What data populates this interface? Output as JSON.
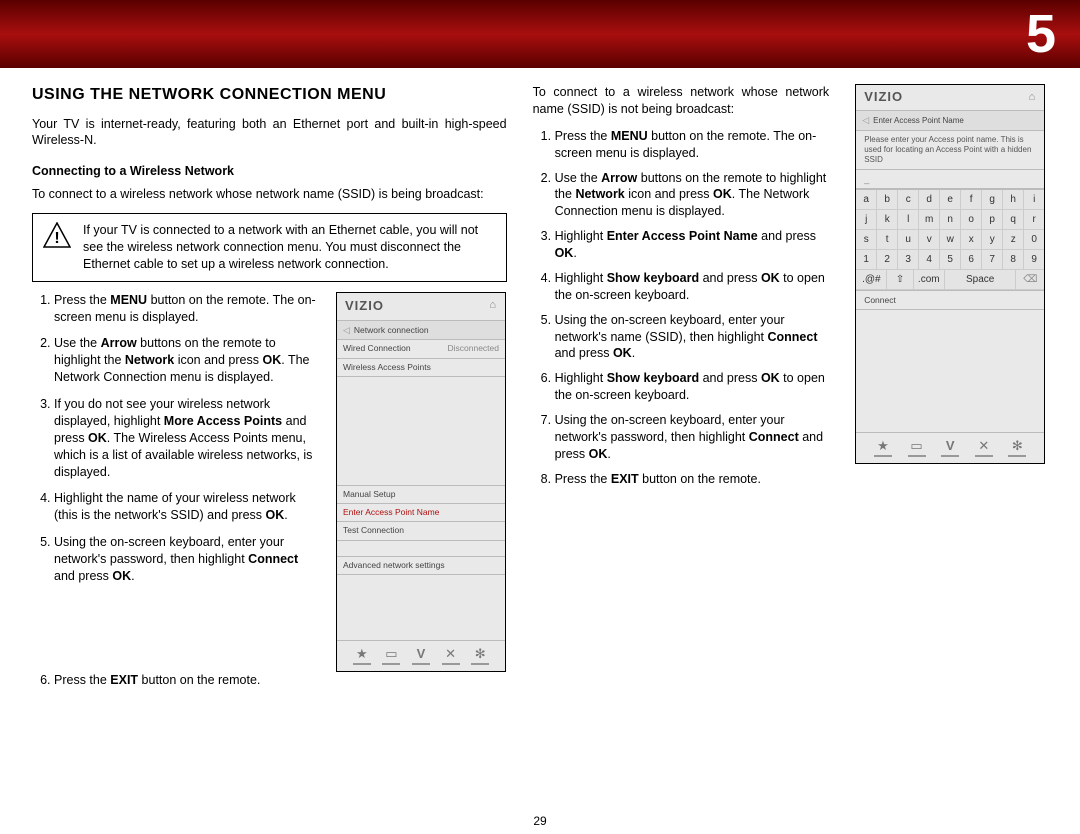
{
  "header": {
    "chapter_number": "5"
  },
  "col1": {
    "title": "USING THE NETWORK CONNECTION MENU",
    "intro": "Your TV is internet-ready, featuring both an Ethernet port and built-in high-speed Wireless-N.",
    "subhead": "Connecting to a Wireless Network",
    "lead_in": "To connect to a wireless network whose network name (SSID) is being broadcast:",
    "note": "If your TV is connected to a network with an Ethernet cable, you will not see the wireless network connection menu. You must disconnect the Ethernet cable to set up a wireless network connection.",
    "steps": [
      {
        "pre": "Press the ",
        "b": "MENU",
        "post": " button on the remote. The on-screen menu is displayed."
      },
      {
        "pre": "Use the ",
        "b": "Arrow",
        "mid": " buttons on the remote to highlight the ",
        "b2": "Network",
        "mid2": " icon and press ",
        "b3": "OK",
        "post": ". The Network Connection menu is displayed."
      },
      {
        "pre": "If you do not see your wireless network displayed, highlight ",
        "b": "More Access Points",
        "mid": " and press ",
        "b2": "OK",
        "post": ". The Wireless Access Points menu, which is a list of available wireless networks, is displayed."
      },
      {
        "pre": "Highlight the name of your wireless network (this is the network's SSID) and press ",
        "b": "OK",
        "post": "."
      },
      {
        "pre": "Using the on-screen keyboard, enter your network's password, then highlight ",
        "b": "Connect",
        "mid": " and press ",
        "b2": "OK",
        "post": "."
      },
      {
        "pre": "Press the ",
        "b": "EXIT",
        "post": " button on the remote."
      }
    ],
    "figure1": {
      "brand": "VIZIO",
      "title": "Network connection",
      "wired_label": "Wired Connection",
      "wired_status": "Disconnected",
      "wireless_label": "Wireless Access Points",
      "manual": "Manual Setup",
      "enter_ap": "Enter Access Point Name",
      "test": "Test Connection",
      "advanced": "Advanced network settings"
    }
  },
  "col2": {
    "lead_in": "To connect to a wireless network whose network name (SSID) is not being broadcast:",
    "steps": [
      {
        "pre": "Press the ",
        "b": "MENU",
        "post": " button on the remote. The on-screen menu is displayed."
      },
      {
        "pre": "Use the ",
        "b": "Arrow",
        "mid": " buttons on the remote to highlight the ",
        "b2": "Network",
        "mid2": " icon and press ",
        "b3": "OK",
        "post": ". The Network Connection menu is displayed."
      },
      {
        "pre": "Highlight ",
        "b": "Enter Access Point Name",
        "mid": " and press ",
        "b2": "OK",
        "post": "."
      },
      {
        "pre": "Highlight ",
        "b": "Show keyboard",
        "mid": " and press ",
        "b2": "OK",
        "post": " to open the on-screen keyboard."
      },
      {
        "pre": "Using the on-screen keyboard, enter your network's name (SSID), then highlight ",
        "b": "Connect",
        "mid": " and press ",
        "b2": "OK",
        "post": "."
      },
      {
        "pre": "Highlight ",
        "b": "Show keyboard",
        "mid": " and press ",
        "b2": "OK",
        "post": " to open the on-screen keyboard."
      },
      {
        "pre": "Using the on-screen keyboard, enter your network's password, then highlight ",
        "b": "Connect",
        "mid": " and press ",
        "b2": "OK",
        "post": "."
      },
      {
        "pre": "Press the ",
        "b": "EXIT",
        "post": " button on the remote."
      }
    ]
  },
  "figure2": {
    "brand": "VIZIO",
    "title": "Enter Access Point Name",
    "help": "Please enter your Access point name. This is used for locating an Access Point with a hidden SSID",
    "input_hint": "_",
    "rows": [
      [
        "a",
        "b",
        "c",
        "d",
        "e",
        "f",
        "g",
        "h",
        "i"
      ],
      [
        "j",
        "k",
        "l",
        "m",
        "n",
        "o",
        "p",
        "q",
        "r"
      ],
      [
        "s",
        "t",
        "u",
        "v",
        "w",
        "x",
        "y",
        "z",
        "0"
      ],
      [
        "1",
        "2",
        "3",
        "4",
        "5",
        "6",
        "7",
        "8",
        "9"
      ]
    ],
    "bottom": {
      "sym": ".@#",
      "shift": "⇧",
      "com": ".com",
      "space": "Space",
      "bksp": "⌫"
    },
    "connect": "Connect"
  },
  "footer": {
    "page": "29"
  },
  "icons": {
    "star": "★",
    "tv": "▭",
    "v": "V",
    "x": "✕",
    "gear": "✻",
    "home": "⌂",
    "back": "◁"
  }
}
